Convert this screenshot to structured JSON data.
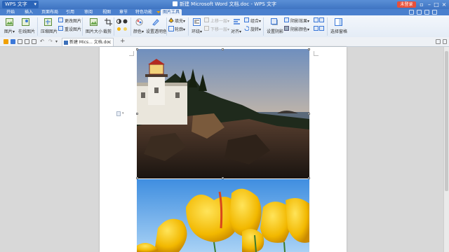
{
  "window": {
    "app_button": "WPS 文字",
    "title": "新建 Microsoft Word 文档.doc - WPS 文字",
    "login_button": "未登录"
  },
  "menu_tabs": [
    {
      "label": "开始"
    },
    {
      "label": "插入"
    },
    {
      "label": "页面布局"
    },
    {
      "label": "引用"
    },
    {
      "label": "审阅"
    },
    {
      "label": "视图"
    },
    {
      "label": "章节"
    },
    {
      "label": "特色功能"
    },
    {
      "label": "图片工具",
      "active": true
    }
  ],
  "ribbon": {
    "insert_picture": "图片",
    "online_picture": "在线图片",
    "compress_picture": "压缩图片",
    "change_picture": "更改图片",
    "reset_picture": "重设图片",
    "picture_size": "图片大小",
    "crop": "裁剪",
    "color": "颜色",
    "set_transparent_color": "设置透明色",
    "fill": "填充",
    "outline": "轮廓",
    "wrap": "环绕",
    "bring_forward": "上移一层",
    "send_backward": "下移一层",
    "align": "对齐",
    "group": "组合",
    "rotate": "旋转",
    "set_shadow": "设置阴影",
    "shadow_effect": "阴影效果",
    "shadow_color": "阴影颜色",
    "selection_pane": "选择窗格"
  },
  "doc_tab": {
    "label": "新建 Mics... 文档.doc"
  },
  "colors": {
    "title_bar": "#4a80ce",
    "login": "#e8503a",
    "ribbon_bg": "#eef3fa",
    "workspace": "#d8d8d8"
  }
}
